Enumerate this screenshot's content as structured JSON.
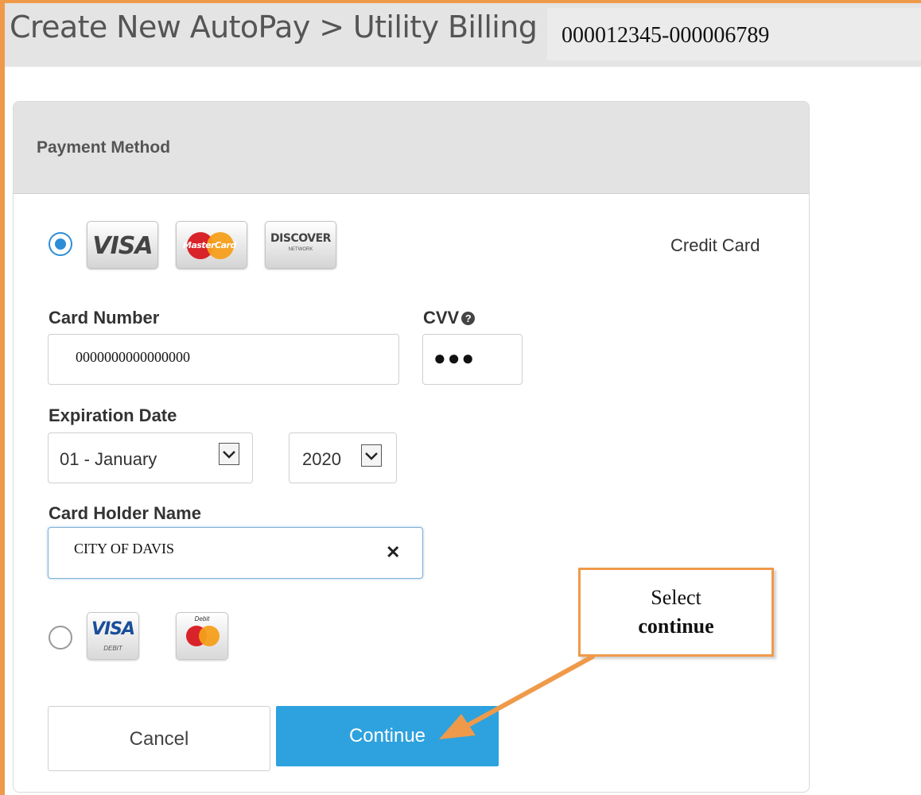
{
  "header": {
    "title": "Create New AutoPay > Utility Billing #",
    "account_number": "000012345-000006789"
  },
  "panel": {
    "title": "Payment Method"
  },
  "credit_option": {
    "selected": true,
    "label": "Credit Card",
    "logos": [
      "visa",
      "mastercard",
      "discover"
    ],
    "visa_text": "VISA",
    "mastercard_text": "MasterCard",
    "discover_text": "DISCOVER",
    "discover_sub": "NETWORK"
  },
  "card_number": {
    "label": "Card Number",
    "value": "0000000000000000"
  },
  "cvv": {
    "label": "CVV",
    "value": "●●●"
  },
  "expiration": {
    "label": "Expiration Date",
    "month": "01 - January",
    "year": "2020"
  },
  "holder": {
    "label": "Card Holder Name",
    "value": "CITY OF DAVIS"
  },
  "debit_option": {
    "selected": false,
    "visa_text": "VISA",
    "visa_sub": "DEBIT",
    "debit_mark": "Debit"
  },
  "buttons": {
    "cancel": "Cancel",
    "continue": "Continue"
  },
  "annotation": {
    "line1": "Select",
    "line2": "continue"
  },
  "colors": {
    "accent": "#2ea2de",
    "frame": "#ef9a4a",
    "radio": "#2d8ed8",
    "header_bg": "#e4e4e4"
  }
}
